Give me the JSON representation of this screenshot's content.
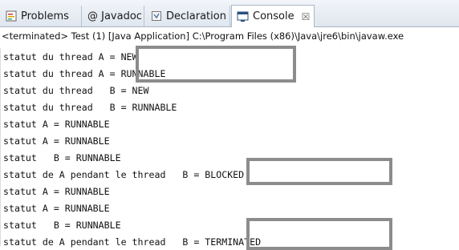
{
  "tabs": [
    {
      "label": "Problems",
      "icon": "problems-icon",
      "active": false
    },
    {
      "label": "@ Javadoc",
      "icon": "",
      "active": false
    },
    {
      "label": "Declaration",
      "icon": "declaration-icon",
      "active": false
    },
    {
      "label": "Console",
      "icon": "console-icon",
      "active": true,
      "close": "☒"
    }
  ],
  "status_line": "<terminated> Test (1) [Java Application] C:\\Program Files (x86)\\Java\\jre6\\bin\\javaw.exe",
  "console_lines": [
    "statut du thread A = NEW",
    "statut du thread A = RUNNABLE",
    "statut du thread   B = NEW",
    "statut du thread   B = RUNNABLE",
    "statut A = RUNNABLE",
    "statut A = RUNNABLE",
    "statut   B = RUNNABLE",
    "statut de A pendant le thread   B = BLOCKED",
    "statut A = RUNNABLE",
    "statut A = RUNNABLE",
    "statut   B = RUNNABLE",
    "statut de A pendant le thread   B = TERMINATED"
  ],
  "highlight_color": "#8c8c8c"
}
